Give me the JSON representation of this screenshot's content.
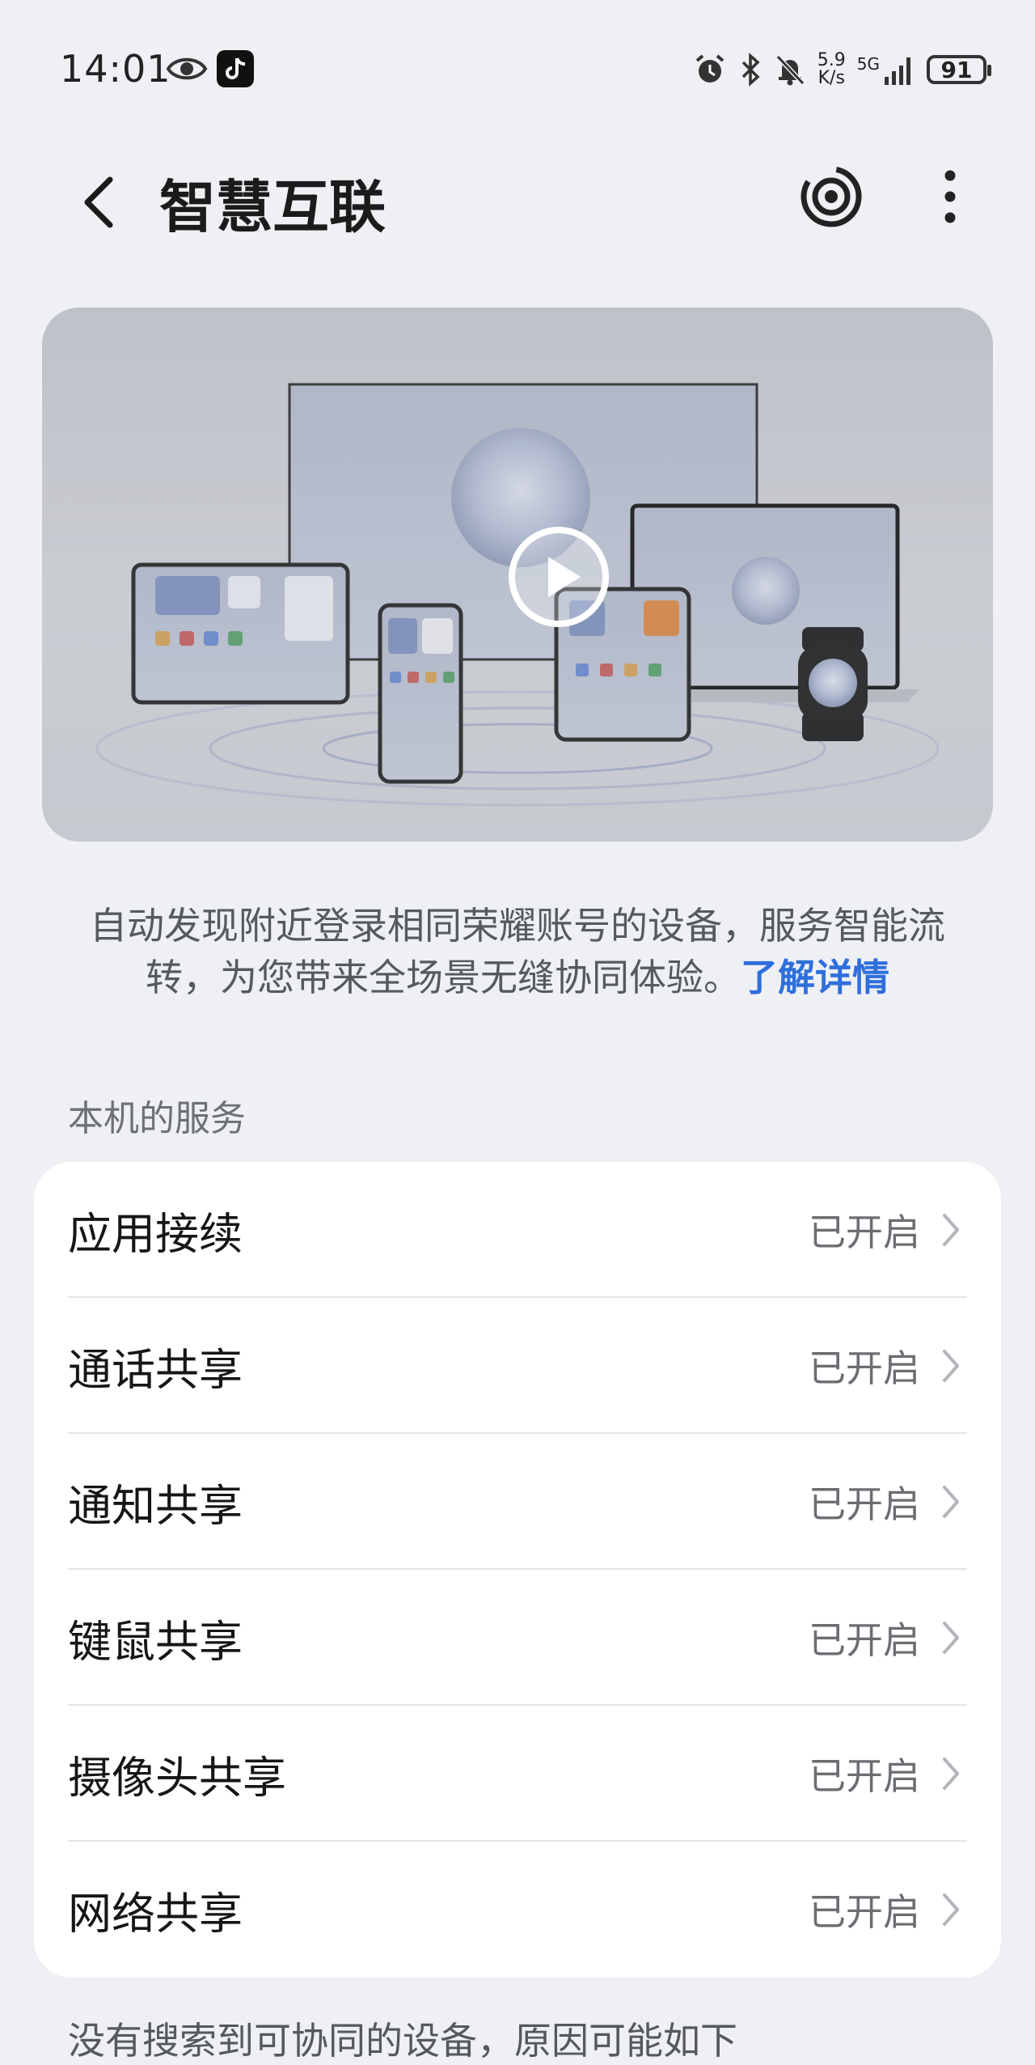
{
  "status_bar": {
    "time": "14:01",
    "net_speed_value": "5.9",
    "net_speed_unit": "K/s",
    "net_type": "5G",
    "battery": "91"
  },
  "header": {
    "title": "智慧互联"
  },
  "description": {
    "text": "自动发现附近登录相同荣耀账号的设备，服务智能流转，为您带来全场景无缝协同体验。",
    "link": "了解详情"
  },
  "section": {
    "title": "本机的服务"
  },
  "services": [
    {
      "label": "应用接续",
      "status": "已开启"
    },
    {
      "label": "通话共享",
      "status": "已开启"
    },
    {
      "label": "通知共享",
      "status": "已开启"
    },
    {
      "label": "键鼠共享",
      "status": "已开启"
    },
    {
      "label": "摄像头共享",
      "status": "已开启"
    },
    {
      "label": "网络共享",
      "status": "已开启"
    }
  ],
  "footer": {
    "text": "没有搜索到可协同的设备，原因可能如下"
  }
}
